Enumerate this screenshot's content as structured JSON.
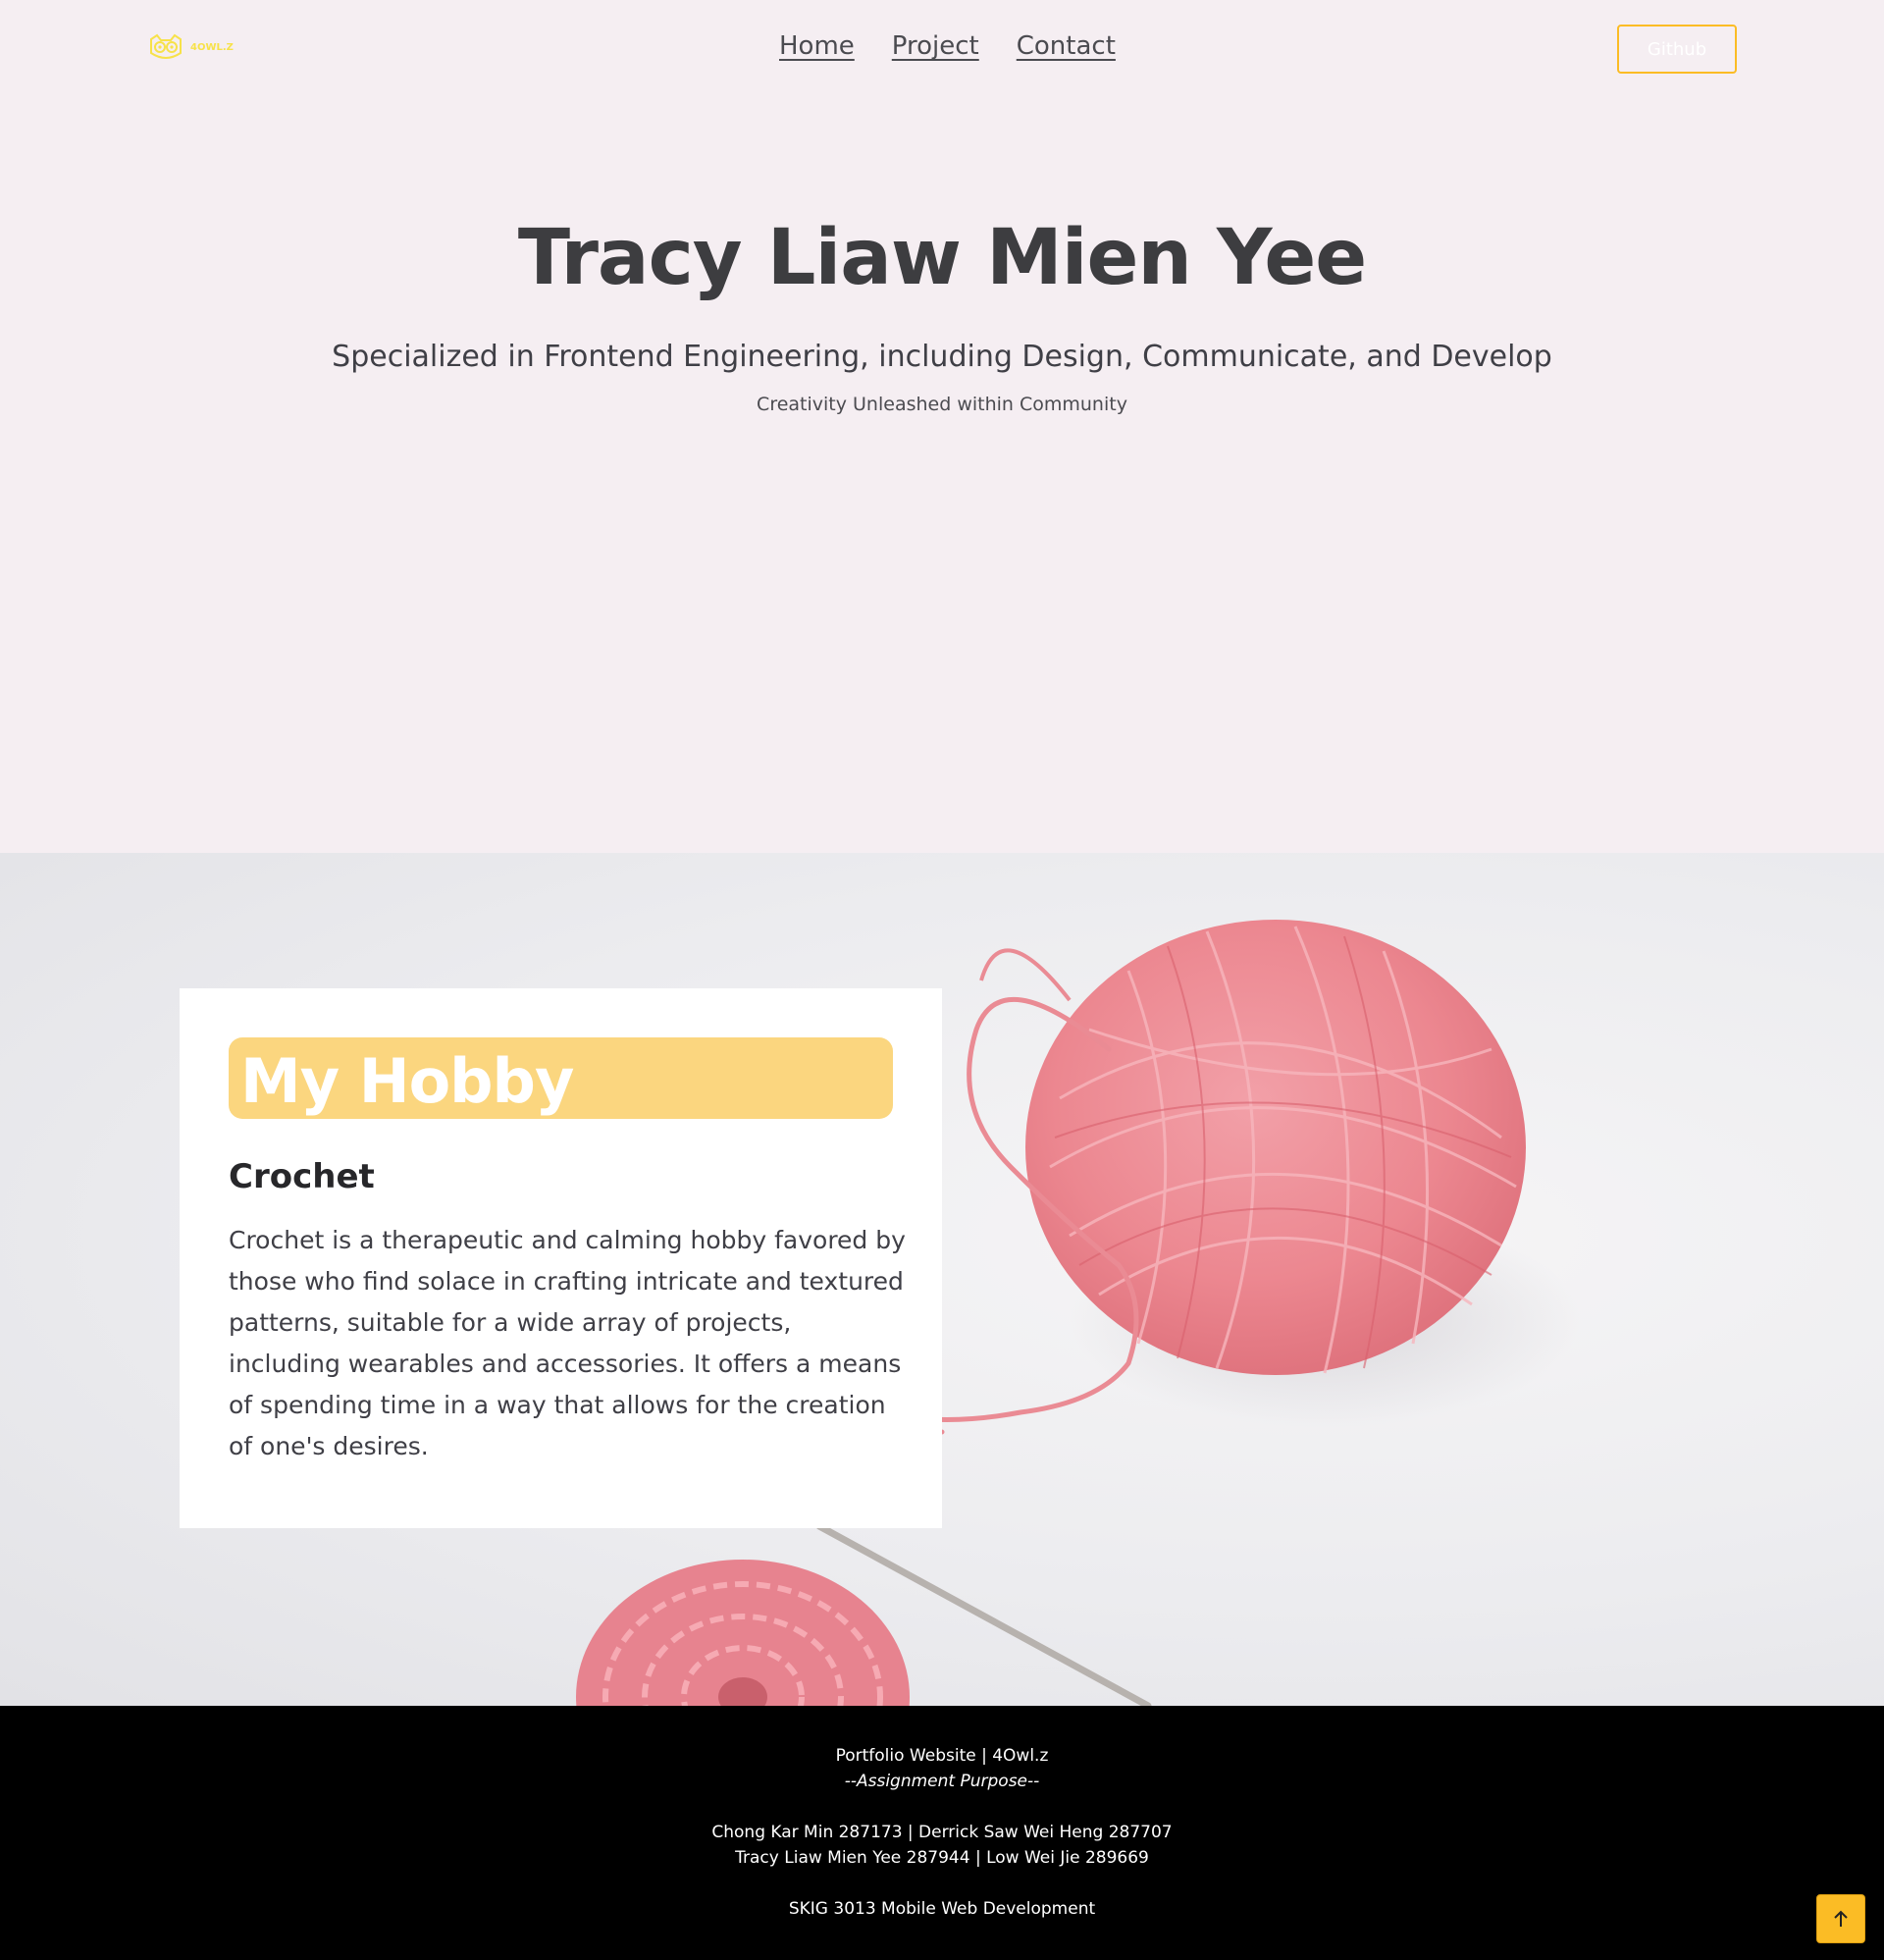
{
  "header": {
    "logo_text": "4OWL.Z",
    "nav": [
      {
        "label": "Home"
      },
      {
        "label": "Project"
      },
      {
        "label": "Contact"
      }
    ],
    "github_label": "Github"
  },
  "hero": {
    "title": "Tracy Liaw Mien Yee",
    "subtitle": "Specialized in Frontend Engineering, including Design, Communicate, and Develop",
    "tagline": "Creativity Unleashed within Community"
  },
  "hobby": {
    "heading": "My Hobby",
    "name": "Crochet",
    "description": "Crochet is a therapeutic and calming hobby favored by those who find solace in crafting intricate and textured patterns, suitable for a wide array of projects, including wearables and accessories. It offers a means of spending time in a way that allows for the creation of one's desires."
  },
  "footer": {
    "site_line": "Portfolio Website | 4Owl.z",
    "purpose": "--Assignment Purpose--",
    "members_line1": "Chong Kar Min 287173 | Derrick Saw Wei Heng 287707",
    "members_line2": "Tracy Liaw Mien Yee 287944 | Low Wei Jie 289669",
    "course": "SKIG 3013 Mobile Web Development"
  },
  "icons": {
    "logo": "owl-logo-icon",
    "back_to_top": "arrow-up-icon"
  },
  "colors": {
    "accent": "#fbbc25",
    "heading_bar": "#fbd67f",
    "hero_bg": "#f5eef2",
    "footer_bg": "#000000"
  }
}
